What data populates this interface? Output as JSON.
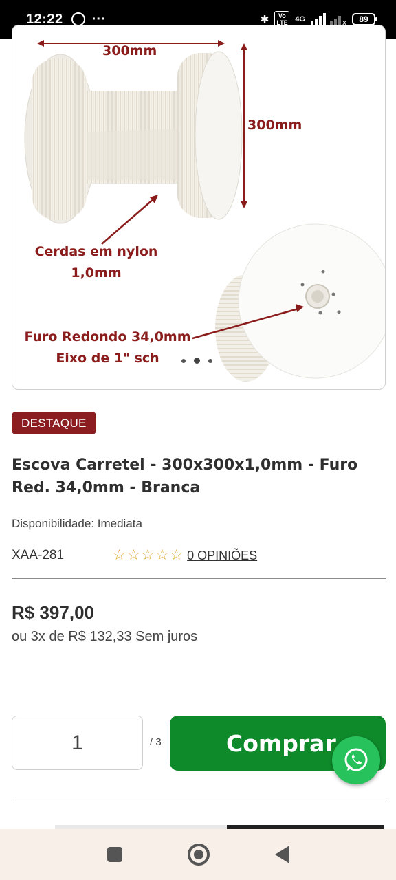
{
  "status_bar": {
    "time": "12:22",
    "more_indicator": "···",
    "network": "4G",
    "volte": "Vo LTE",
    "battery": "89"
  },
  "product_image": {
    "label_width": "300mm",
    "label_height": "300mm",
    "label_bristles_line1": "Cerdas em nylon",
    "label_bristles_line2": "1,0mm",
    "label_hole_line1": "Furo Redondo 34,0mm",
    "label_hole_line2": "Eixo de 1\" sch",
    "annotation_color": "#8a1c1c"
  },
  "product": {
    "badge": "DESTAQUE",
    "title": "Escova Carretel - 300x300x1,0mm - Furo Red. 34,0mm - Branca",
    "availability": "Disponibilidade: Imediata",
    "sku": "XAA-281",
    "rating_stars": 0,
    "rating_max": 5,
    "reviews_link": "0 OPINIÕES",
    "price": "R$ 397,00",
    "installments": "ou 3x de R$ 132,33 Sem juros"
  },
  "purchase": {
    "quantity": "1",
    "stock": "/ 3",
    "buy_label": "Comprar",
    "buy_color": "#0f8a2b"
  },
  "colors": {
    "badge": "#8b1d21",
    "whatsapp": "#27c25b",
    "star": "#e0a82e"
  }
}
